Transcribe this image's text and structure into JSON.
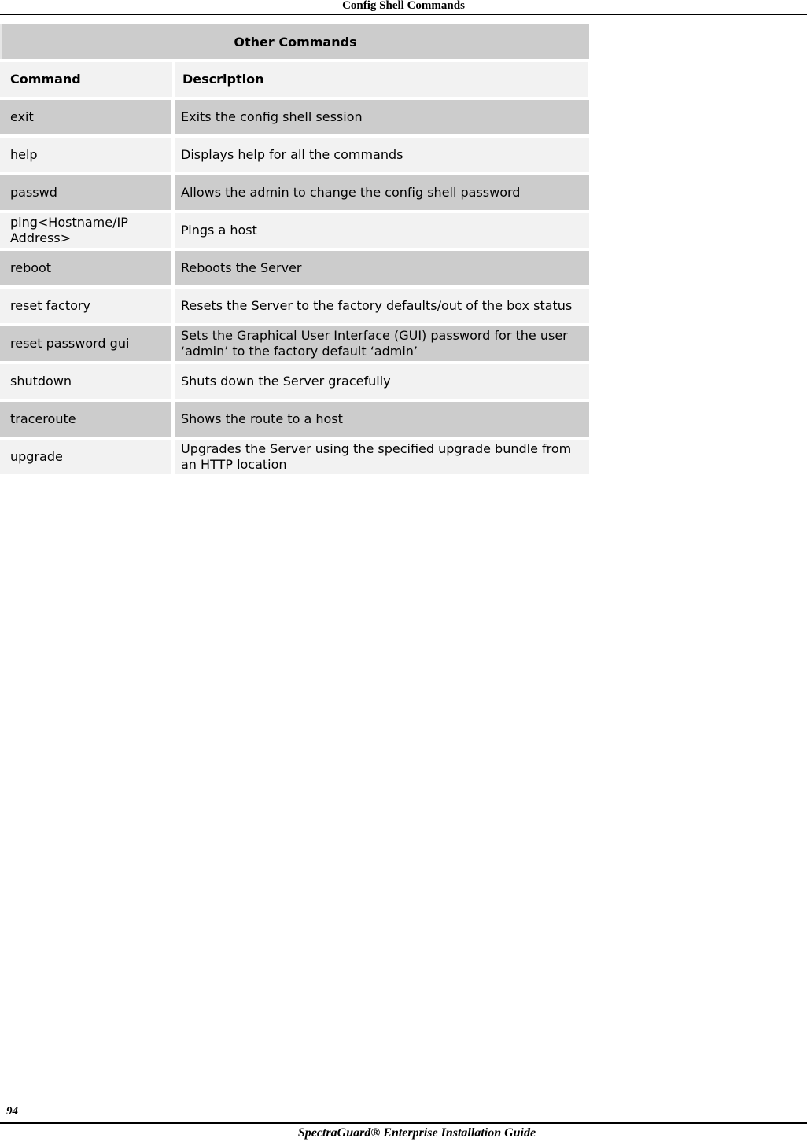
{
  "page": {
    "header_title": "Config Shell Commands",
    "page_number": "94",
    "footer_title": "SpectraGuard® Enterprise Installation Guide"
  },
  "table": {
    "title": "Other Commands",
    "columns": [
      "Command",
      "Description"
    ],
    "rows": [
      {
        "command": "exit",
        "description": "Exits the config shell session"
      },
      {
        "command": "help",
        "description": "Displays help for all the commands"
      },
      {
        "command": "passwd",
        "description": "Allows the admin to change the config shell password"
      },
      {
        "command": "ping<Hostname/IP Address>",
        "description": "Pings a host"
      },
      {
        "command": "reboot",
        "description": "Reboots the Server"
      },
      {
        "command": "reset factory",
        "description": "Resets the Server to the factory defaults/out of the box status"
      },
      {
        "command": "reset password gui",
        "description": "Sets the Graphical User Interface (GUI) password for the user ‘admin’ to the factory default ‘admin’"
      },
      {
        "command": "shutdown",
        "description": "Shuts down the Server gracefully"
      },
      {
        "command": "traceroute",
        "description": "Shows the route to a host"
      },
      {
        "command": "upgrade",
        "description": "Upgrades the Server using the specified upgrade bundle from an HTTP location"
      }
    ]
  }
}
